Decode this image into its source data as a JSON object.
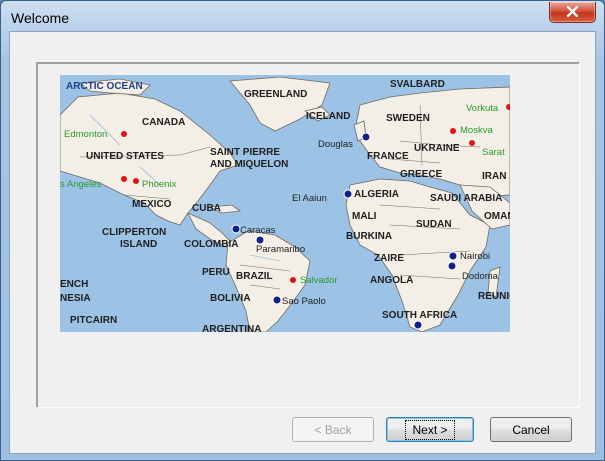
{
  "window": {
    "title": "Welcome"
  },
  "buttons": {
    "back": "< Back",
    "next": "Next >",
    "cancel": "Cancel"
  },
  "map": {
    "regions": {
      "arctic_ocean": "ARCTIC OCEAN",
      "greenland": "GREENLAND",
      "iceland": "ICELAND",
      "svalbard": "SVALBARD",
      "sweden": "SWEDEN",
      "canada": "CANADA",
      "united_states": "UNITED STATES",
      "saint_pierre": "SAINT PIERRE",
      "and_miquelon": "AND MIQUELON",
      "france": "FRANCE",
      "ukraine": "UKRAINE",
      "greece": "GREECE",
      "iran": "IRAN",
      "mexico": "MEXICO",
      "cuba": "CUBA",
      "algeria": "ALGERIA",
      "saudi_arabia": "SAUDI ARABIA",
      "oman": "OMAN",
      "mali": "MALI",
      "sudan": "SUDAN",
      "burkina": "BURKINA",
      "clipperton_1": "CLIPPERTON",
      "clipperton_2": "ISLAND",
      "colombia": "COLOMBIA",
      "zaire": "ZAIRE",
      "peru": "PERU",
      "brazil": "BRAZIL",
      "angola": "ANGOLA",
      "bolivia": "BOLIVIA",
      "reunion": "REUNIO",
      "pitcairn": "PITCAIRN",
      "argentina": "ARGENTINA",
      "south_africa": "SOUTH AFRICA",
      "french_poly_1": "ENCH",
      "french_poly_2": "NESIA"
    },
    "cities": {
      "edmonton": "Edmonton",
      "los_angeles": "s Angeles",
      "phoenix": "Phoenix",
      "vorkuta": "Vorkuta",
      "moskva": "Moskva",
      "saratov": "Sarat",
      "salvador": "Salvador",
      "douglas": "Douglas",
      "el_aaiun": "El Aaiun",
      "caracas": "Caracas",
      "paramaribo": "Paramaribo",
      "nairobi": "Nairobi",
      "dodoma": "Dodoma",
      "sao_paolo": "Sao Paolo"
    },
    "colors": {
      "ocean": "#9cc3e6",
      "land": "#f3efe6",
      "border": "#6f6a60",
      "region_label": "#1f1f1f",
      "city_green": "#2a9a2a",
      "marker_red": "#e01414",
      "marker_blue": "#10208a"
    }
  }
}
